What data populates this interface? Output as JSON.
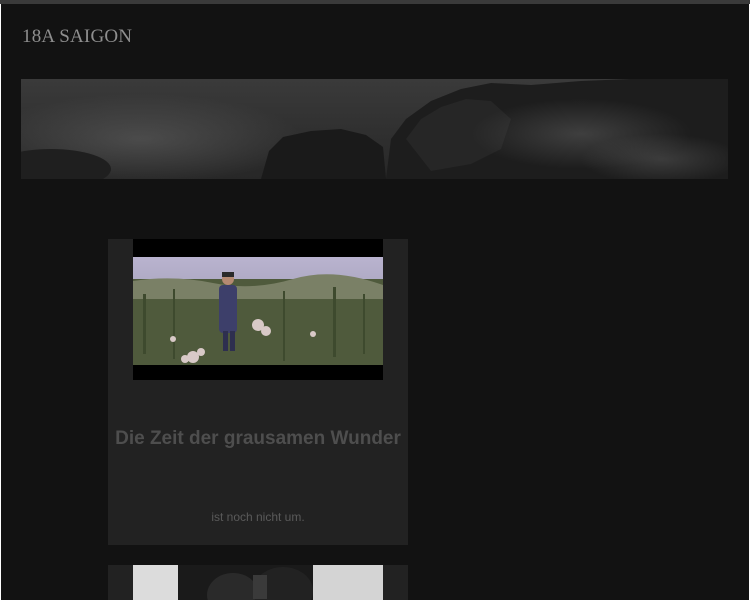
{
  "site": {
    "title": "18A SAIGON"
  },
  "header": {
    "banner_image": "misty-mountain-cliffs-banner"
  },
  "posts": [
    {
      "title": "Die Zeit der grausamen Wunder",
      "excerpt": "ist noch nicht um.",
      "thumbnail": "man-standing-in-flower-field-film-still"
    },
    {
      "thumbnail": "people-in-doorway-film-still"
    }
  ],
  "colors": {
    "page_background": "#121212",
    "card_background": "#222222",
    "title_text": "#8e8e8e",
    "post_title_text": "#4e4e4e",
    "excerpt_text": "#5a5a5a"
  }
}
